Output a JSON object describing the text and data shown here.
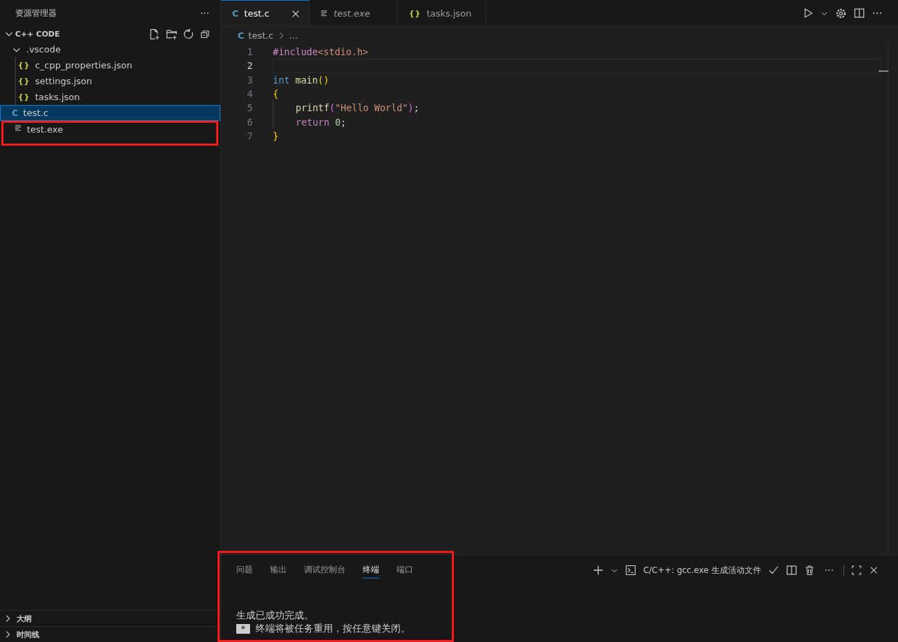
{
  "sidebar": {
    "title": "资源管理器",
    "more": "···",
    "folder": {
      "name": "C++ CODE",
      "expanded": true
    },
    "tree": [
      {
        "name": ".vscode",
        "kind": "folder",
        "expanded": true,
        "selected": false,
        "highlighted": false,
        "children": [
          {
            "name": "c_cpp_properties.json",
            "kind": "json",
            "icon": "{}",
            "selected": false,
            "highlighted": false
          },
          {
            "name": "settings.json",
            "kind": "json",
            "icon": "{}",
            "selected": false,
            "highlighted": false
          },
          {
            "name": "tasks.json",
            "kind": "json",
            "icon": "{}",
            "selected": false,
            "highlighted": false
          }
        ]
      },
      {
        "name": "test.c",
        "kind": "c",
        "icon": "C",
        "selected": true,
        "highlighted": false
      },
      {
        "name": "test.exe",
        "kind": "binary",
        "selected": false,
        "highlighted": true
      }
    ],
    "sections": [
      {
        "name": "大纲",
        "expanded": false
      },
      {
        "name": "时间线",
        "expanded": false
      }
    ]
  },
  "tabs": [
    {
      "label": "test.c",
      "kind": "c",
      "icon": "C",
      "selected": true,
      "preview": false
    },
    {
      "label": "test.exe",
      "kind": "binary",
      "selected": false,
      "preview": true
    },
    {
      "label": "tasks.json",
      "kind": "json",
      "icon": "{}",
      "selected": false,
      "preview": false
    }
  ],
  "breadcrumb": {
    "icon": "C",
    "file": "test.c",
    "rest": "..."
  },
  "code": [
    {
      "number": "1",
      "current": false,
      "indent": false,
      "tokens": [
        {
          "t": "#include",
          "kind": "directive"
        },
        {
          "t": "<stdio.h>",
          "kind": "string"
        }
      ]
    },
    {
      "number": "2",
      "current": true,
      "indent": false
    },
    {
      "number": "3",
      "current": false,
      "indent": false,
      "tokens": [
        {
          "t": "int ",
          "kind": "keyword"
        },
        {
          "t": "main",
          "kind": "function"
        },
        {
          "t": "()",
          "kind": "bracket"
        }
      ]
    },
    {
      "number": "4",
      "current": false,
      "indent": false,
      "tokens": [
        {
          "t": "{",
          "kind": "bracket"
        }
      ]
    },
    {
      "number": "5",
      "current": false,
      "indent": true,
      "tokens": [
        {
          "t": "printf",
          "kind": "function"
        },
        {
          "t": "(",
          "kind": "bracket2"
        },
        {
          "t": "\"Hello World\"",
          "kind": "string"
        },
        {
          "t": ")",
          "kind": "bracket2"
        },
        {
          "t": ";",
          "kind": "plain"
        }
      ]
    },
    {
      "number": "6",
      "current": false,
      "indent": true,
      "tokens": [
        {
          "t": "return ",
          "kind": "control"
        },
        {
          "t": "0",
          "kind": "number"
        },
        {
          "t": ";",
          "kind": "plain"
        }
      ]
    },
    {
      "number": "7",
      "current": false,
      "indent": false,
      "tokens": [
        {
          "t": "}",
          "kind": "bracket"
        }
      ]
    }
  ],
  "panel": {
    "highlighted": true,
    "tabs": [
      {
        "label": "问题",
        "selected": false
      },
      {
        "label": "输出",
        "selected": false
      },
      {
        "label": "调试控制台",
        "selected": false
      },
      {
        "label": "终端",
        "selected": true
      },
      {
        "label": "端口",
        "selected": false
      }
    ],
    "task": "C/C++: gcc.exe 生成活动文件",
    "more": "···",
    "terminal": [
      {
        "kind": "line",
        "text": "生成已成功完成。"
      },
      {
        "kind": "marked",
        "mark": "*",
        "text": "终端将被任务重用，按任意键关闭。"
      }
    ]
  }
}
